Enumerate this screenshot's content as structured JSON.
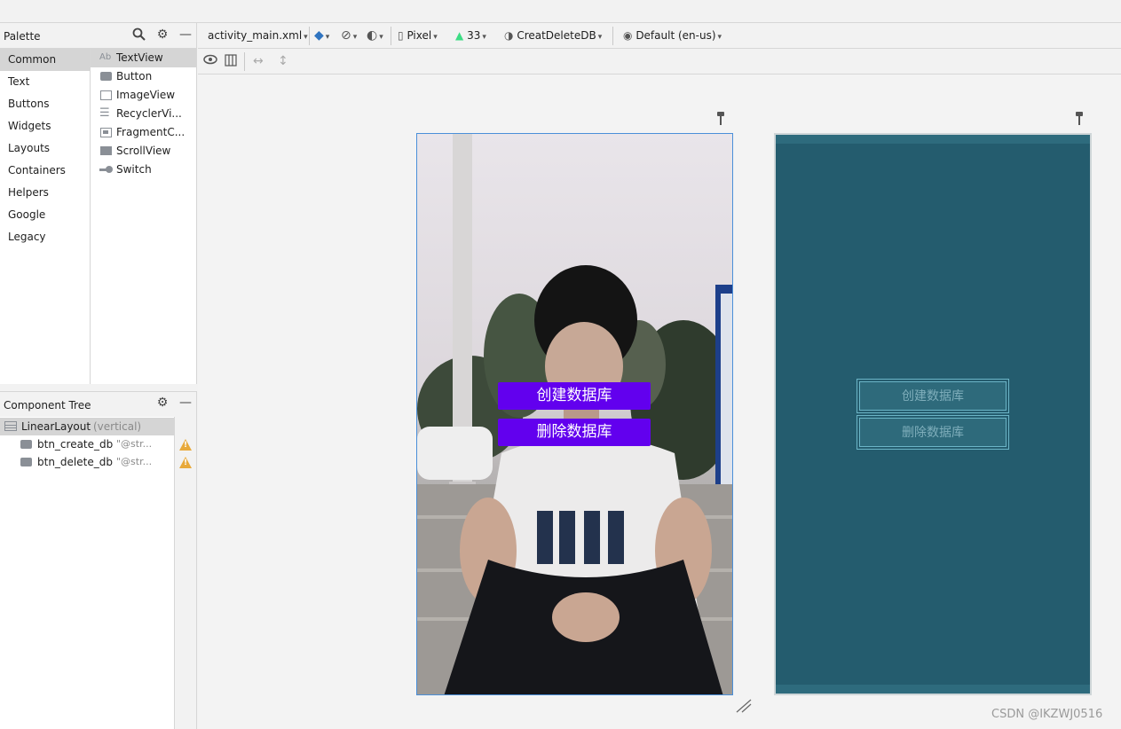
{
  "palette": {
    "title": "Palette",
    "categories": [
      "Common",
      "Text",
      "Buttons",
      "Widgets",
      "Layouts",
      "Containers",
      "Helpers",
      "Google",
      "Legacy"
    ],
    "widgets": [
      {
        "label": "TextView",
        "icon": "Ab"
      },
      {
        "label": "Button",
        "icon": ""
      },
      {
        "label": "ImageView",
        "icon": ""
      },
      {
        "label": "RecyclerVi...",
        "icon": ""
      },
      {
        "label": "FragmentC...",
        "icon": ""
      },
      {
        "label": "ScrollView",
        "icon": ""
      },
      {
        "label": "Switch",
        "icon": ""
      }
    ]
  },
  "component_tree": {
    "title": "Component Tree",
    "root": {
      "label": "LinearLayout",
      "hint": "(vertical)"
    },
    "children": [
      {
        "label": "btn_create_db",
        "hint": "\"@str..."
      },
      {
        "label": "btn_delete_db",
        "hint": "\"@str..."
      }
    ]
  },
  "toolbar": {
    "file": "activity_main.xml",
    "device": "Pixel",
    "api": "33",
    "theme": "CreatDeleteDB",
    "locale": "Default (en-us)"
  },
  "design": {
    "create_button": "创建数据库",
    "delete_button": "删除数据库"
  },
  "blueprint": {
    "create_button": "创建数据库",
    "delete_button": "删除数据库"
  },
  "watermark": "CSDN @IKZWJ0516",
  "colors": {
    "accent_button": "#6200ee",
    "blueprint_bg": "#245c6e",
    "selection_border": "#4a8fd9"
  }
}
